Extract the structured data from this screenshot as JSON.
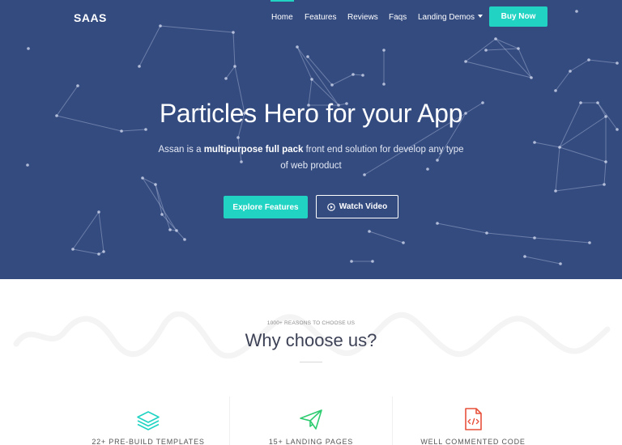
{
  "nav": {
    "logo": "SAAS",
    "links": [
      {
        "label": "Home",
        "active": true
      },
      {
        "label": "Features",
        "active": false
      },
      {
        "label": "Reviews",
        "active": false
      },
      {
        "label": "Faqs",
        "active": false
      },
      {
        "label": "Landing Demos",
        "active": false
      }
    ],
    "cta": "Buy Now"
  },
  "hero": {
    "title": "Particles Hero for your App",
    "subtitle_pre": "Assan is a ",
    "subtitle_bold": "multipurpose full pack",
    "subtitle_post": " front end solution for develop any type of web product",
    "primary_button": "Explore Features",
    "secondary_button": "Watch Video"
  },
  "why": {
    "eyebrow": "1000+ REASONS TO CHOOSE US",
    "title": "Why choose us?",
    "features": [
      {
        "label": "22+ PRE-BUILD TEMPLATES",
        "icon": "layers-icon"
      },
      {
        "label": "15+ LANDING PAGES",
        "icon": "paper-plane-icon"
      },
      {
        "label": "WELL COMMENTED CODE",
        "icon": "code-file-icon"
      }
    ]
  },
  "colors": {
    "hero_bg": "#344b80",
    "accent": "#20d3c2",
    "code_icon": "#e8503a"
  }
}
